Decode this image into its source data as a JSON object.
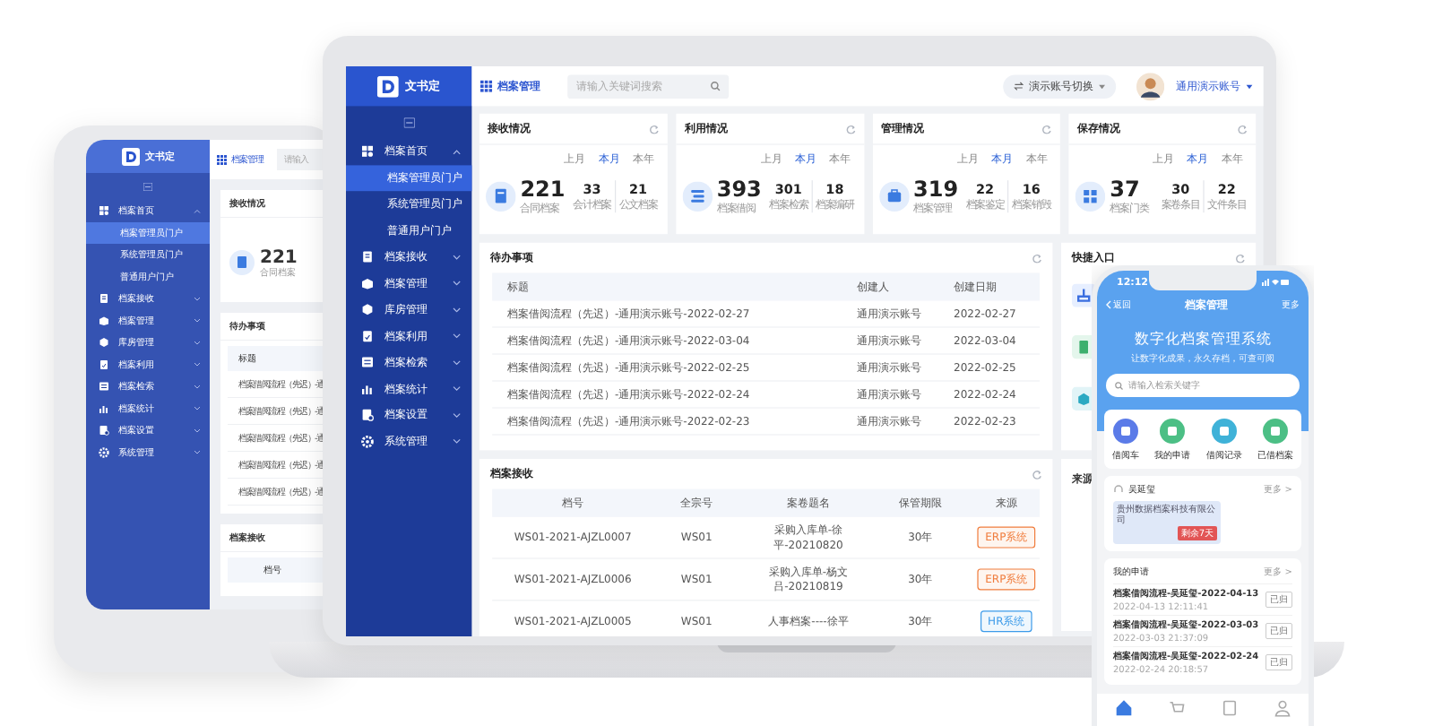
{
  "tablet": {
    "logo": "文书定",
    "header_title": "档案管理",
    "search_placeholder": "请输入",
    "sidebar": [
      {
        "label": "档案首页",
        "expanded": true,
        "children": [
          {
            "label": "档案管理员门户",
            "selected": true
          },
          {
            "label": "系统管理员门户",
            "selected": false
          },
          {
            "label": "普通用户门户",
            "selected": false
          }
        ]
      },
      {
        "label": "档案接收",
        "expanded": false
      },
      {
        "label": "档案管理",
        "expanded": false
      },
      {
        "label": "库房管理",
        "expanded": false
      },
      {
        "label": "档案利用",
        "expanded": false
      },
      {
        "label": "档案检索",
        "expanded": false
      },
      {
        "label": "档案统计",
        "expanded": false
      },
      {
        "label": "档案设置",
        "expanded": false
      },
      {
        "label": "系统管理",
        "expanded": false
      }
    ],
    "stat": {
      "title": "接收情况",
      "value": "221",
      "label": "合同档案"
    },
    "todo": {
      "title": "待办事项",
      "column": "标题",
      "rows": [
        "档案借阅流程（先迟）-通",
        "档案借阅流程（先迟）-通",
        "档案借阅流程（先迟）-通",
        "档案借阅流程（先迟）-通",
        "档案借阅流程（先迟）-通"
      ]
    },
    "archive": {
      "title": "档案接收",
      "column": "档号"
    }
  },
  "laptop": {
    "logo": "文书定",
    "header_title": "档案管理",
    "search_placeholder": "请输入关键词搜索",
    "account_switch": "演示账号切换",
    "user": "通用演示账号",
    "sidebar": [
      {
        "label": "档案首页",
        "expanded": true,
        "children": [
          {
            "label": "档案管理员门户",
            "selected": true
          },
          {
            "label": "系统管理员门户",
            "selected": false
          },
          {
            "label": "普通用户门户",
            "selected": false
          }
        ]
      },
      {
        "label": "档案接收",
        "expanded": false
      },
      {
        "label": "档案管理",
        "expanded": false
      },
      {
        "label": "库房管理",
        "expanded": false
      },
      {
        "label": "档案利用",
        "expanded": false
      },
      {
        "label": "档案检索",
        "expanded": false
      },
      {
        "label": "档案统计",
        "expanded": false
      },
      {
        "label": "档案设置",
        "expanded": false
      },
      {
        "label": "系统管理",
        "expanded": false
      }
    ],
    "stats": [
      {
        "title": "接收情况",
        "periods": [
          {
            "label": "上月",
            "selected": false
          },
          {
            "label": "本月",
            "selected": true
          },
          {
            "label": "本年",
            "selected": false
          }
        ],
        "value": "221",
        "label": "合同档案",
        "subs": [
          {
            "value": "33",
            "label": "会计档案"
          },
          {
            "value": "21",
            "label": "公文档案"
          }
        ]
      },
      {
        "title": "利用情况",
        "periods": [
          {
            "label": "上月",
            "selected": false
          },
          {
            "label": "本月",
            "selected": true
          },
          {
            "label": "本年",
            "selected": false
          }
        ],
        "value": "393",
        "label": "档案借阅",
        "subs": [
          {
            "value": "301",
            "label": "档案检索"
          },
          {
            "value": "18",
            "label": "档案编研"
          }
        ]
      },
      {
        "title": "管理情况",
        "periods": [
          {
            "label": "上月",
            "selected": false
          },
          {
            "label": "本月",
            "selected": true
          },
          {
            "label": "本年",
            "selected": false
          }
        ],
        "value": "319",
        "label": "档案管理",
        "subs": [
          {
            "value": "22",
            "label": "档案鉴定"
          },
          {
            "value": "16",
            "label": "档案销毁"
          }
        ]
      },
      {
        "title": "保存情况",
        "periods": [
          {
            "label": "上月",
            "selected": false
          },
          {
            "label": "本月",
            "selected": true
          },
          {
            "label": "本年",
            "selected": false
          }
        ],
        "value": "37",
        "label": "档案门类",
        "subs": [
          {
            "value": "30",
            "label": "案卷条目"
          },
          {
            "value": "22",
            "label": "文件条目"
          }
        ]
      }
    ],
    "todo": {
      "title": "待办事项",
      "columns": [
        "标题",
        "创建人",
        "创建日期"
      ],
      "rows": [
        [
          "档案借阅流程（先迟）-通用演示账号-2022-02-27",
          "通用演示账号",
          "2022-02-27"
        ],
        [
          "档案借阅流程（先迟）-通用演示账号-2022-03-04",
          "通用演示账号",
          "2022-03-04"
        ],
        [
          "档案借阅流程（先迟）-通用演示账号-2022-02-25",
          "通用演示账号",
          "2022-02-25"
        ],
        [
          "档案借阅流程（先迟）-通用演示账号-2022-02-24",
          "通用演示账号",
          "2022-02-24"
        ],
        [
          "档案借阅流程（先迟）-通用演示账号-2022-02-23",
          "通用演示账号",
          "2022-02-23"
        ]
      ]
    },
    "archive": {
      "title": "档案接收",
      "columns": [
        "档号",
        "全宗号",
        "案卷题名",
        "保管期限",
        "来源"
      ],
      "rows": [
        {
          "cells": [
            "WS01-2021-AJZL0007",
            "WS01",
            "采购入库单-徐平-20210820",
            "30年"
          ],
          "source": "ERP系统",
          "color": "#f07c3c"
        },
        {
          "cells": [
            "WS01-2021-AJZL0006",
            "WS01",
            "采购入库单-杨文吕-20210819",
            "30年"
          ],
          "source": "ERP系统",
          "color": "#f07c3c"
        },
        {
          "cells": [
            "WS01-2021-AJZL0005",
            "WS01",
            "人事档案----徐平",
            "30年"
          ],
          "source": "HR系统",
          "color": "#3d9be9"
        }
      ]
    },
    "shortcuts": {
      "title": "快捷入口"
    },
    "side_table": {
      "column": "来源"
    }
  },
  "phone": {
    "time": "12:12",
    "back": "返回",
    "title": "档案管理",
    "more": "更多",
    "hero_title": "数字化档案管理系统",
    "hero_subtitle": "让数字化成果，永久存档，可查可阅",
    "search_placeholder": "请输入检索关键字",
    "actions": [
      {
        "label": "借阅车",
        "color": "#5b7be8"
      },
      {
        "label": "我的申请",
        "color": "#4cbf85"
      },
      {
        "label": "借阅记录",
        "color": "#3fb2d8"
      },
      {
        "label": "已借档案",
        "color": "#4cbf85"
      }
    ],
    "cart": {
      "title": "吴延玺",
      "more": "更多 >",
      "company": "贵州数据档案科技有限公司",
      "badge": "剩余7天"
    },
    "applications": {
      "title": "我的申请",
      "more": "更多 >",
      "items": [
        {
          "title": "档案借阅流程-吴延玺-2022-04-13",
          "time": "2022-04-13 12:11:41",
          "status": "已归"
        },
        {
          "title": "档案借阅流程-吴延玺-2022-03-03",
          "time": "2022-03-03 21:37:09",
          "status": "已归"
        },
        {
          "title": "档案借阅流程-吴延玺-2022-02-24",
          "time": "2022-02-24 20:18:57",
          "status": "已归"
        }
      ]
    },
    "tabs": [
      {
        "selected": true
      },
      {
        "selected": false
      },
      {
        "selected": false
      },
      {
        "selected": false
      }
    ]
  }
}
